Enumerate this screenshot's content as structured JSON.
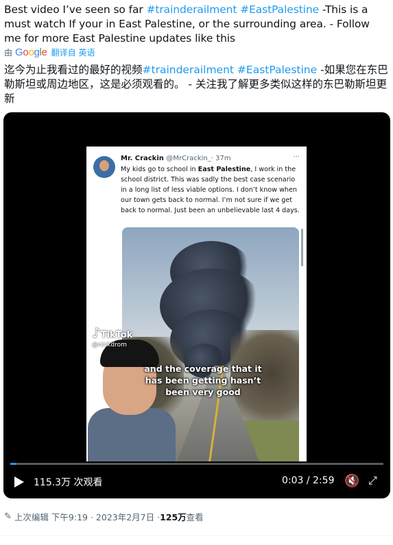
{
  "post": {
    "text_before": "Best video I’ve seen so far ",
    "hashtag1": "#trainderailment",
    "hashtag2": "#EastPalestine",
    "text_after": " -This is a must watch If your in East Palestine, or the surrounding area. - Follow me for more East Palestine updates like this"
  },
  "translation": {
    "by_label": "由",
    "google_letters": [
      "G",
      "o",
      "o",
      "g",
      "l",
      "e"
    ],
    "google_colors": [
      "#4285F4",
      "#EA4335",
      "#FBBC05",
      "#4285F4",
      "#34A853",
      "#EA4335"
    ],
    "link_label": "翻译自 英语",
    "cn_before": "迄今为止我看过的最好的视频",
    "cn_hashtag1": "#trainderailment",
    "cn_hashtag2": "#EastPalestine",
    "cn_after": " -如果您在东巴勒斯坦或周边地区，这是必须观看的。 - 关注我了解更多类似这样的东巴勒斯坦更新"
  },
  "video": {
    "embedded_tweet": {
      "name": "Mr. Crackin",
      "handle": "@MrCrackin_",
      "age": "· 37m",
      "dots": "···",
      "body_before": "My kids go to school in ",
      "body_bold": "East Palestine",
      "body_after": ", I work in the school district. This was sadly the best case scenario in a long list of less viable options. I don’t know when our town gets back to normal. I’m not sure if we get back to normal. Just been an unbelievable last 4 days."
    },
    "tiktok_label": "TikTok",
    "tiktok_user": "@nickdrom",
    "caption": "and the coverage that it has been getting hasn’t been very good",
    "progress": 0.017,
    "views": "115.3万 次观看",
    "time": "0:03 / 2:59",
    "icons": [
      "play-icon",
      "volume-muted-icon",
      "fullscreen-icon"
    ]
  },
  "meta": {
    "edited_label": "上次编辑",
    "time": "下午9:19 · 2023年2月7日 · ",
    "views_count": "125万",
    "views_label": " 查看"
  },
  "colors": {
    "accent": "#1d9bf0",
    "text": "#0f1419",
    "muted": "#536471"
  }
}
